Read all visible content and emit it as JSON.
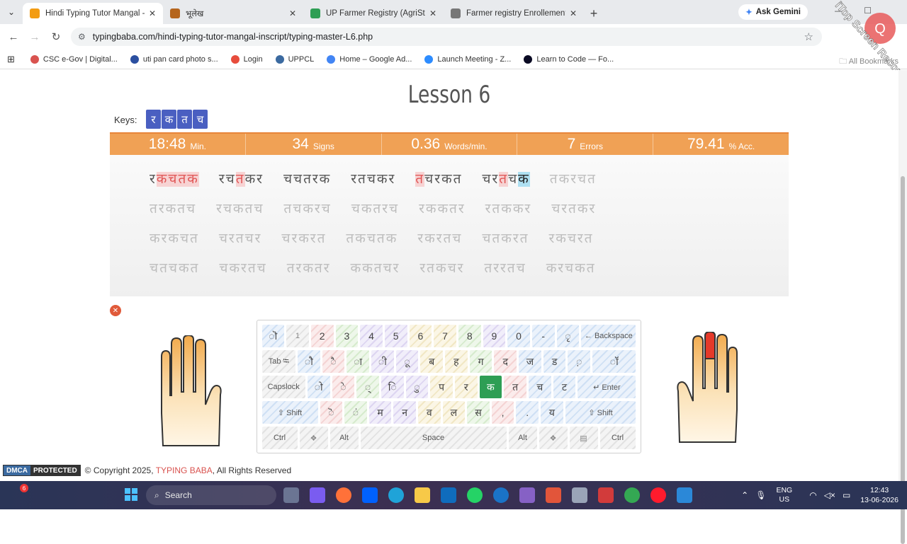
{
  "browser": {
    "tabs": [
      {
        "title": "Hindi Typing Tutor Mangal - Ins",
        "active": true,
        "color": "#f39c12"
      },
      {
        "title": "भूलेख",
        "active": false,
        "color": "#b5651d"
      },
      {
        "title": "UP Farmer Registry (AgriStack) |",
        "active": false,
        "color": "#2e9e54"
      },
      {
        "title": "Farmer registry Enrollement Da",
        "active": false,
        "color": "#777777"
      }
    ],
    "ask_gemini": "Ask Gemini",
    "url": "typingbaba.com/hindi-typing-tutor-mangal-inscript/typing-master-L6.php",
    "bookmarks": [
      {
        "label": "CSC e-Gov | Digital...",
        "color": "#d9534f"
      },
      {
        "label": "uti pan card photo s...",
        "color": "#2b4fa0"
      },
      {
        "label": "Login",
        "color": "#e74c3c"
      },
      {
        "label": "UPPCL",
        "color": "#3b6aa0"
      },
      {
        "label": "Home – Google Ad...",
        "color": "#4285f4"
      },
      {
        "label": "Launch Meeting - Z...",
        "color": "#2d8cff"
      },
      {
        "label": "Learn to Code — Fo...",
        "color": "#0a0a23"
      }
    ],
    "all_bookmarks": "All Bookmarks",
    "watermark": "iTop Screen Recorder"
  },
  "lesson": {
    "title": "Lesson 6",
    "keys_label": "Keys:",
    "keys": [
      "र",
      "क",
      "त",
      "च"
    ]
  },
  "stats": [
    {
      "value": "18:48",
      "unit": "Min."
    },
    {
      "value": "34",
      "unit": "Signs"
    },
    {
      "value": "0.36",
      "unit": "Words/min."
    },
    {
      "value": "7",
      "unit": "Errors"
    },
    {
      "value": "79.41",
      "unit": "% Acc."
    }
  ],
  "typing": {
    "line1": [
      {
        "segs": [
          {
            "t": "र",
            "s": "ok"
          },
          {
            "t": "कचतक",
            "s": "err"
          }
        ]
      },
      {
        "segs": [
          {
            "t": "रच",
            "s": "ok"
          },
          {
            "t": "त",
            "s": "err"
          },
          {
            "t": "कर",
            "s": "ok"
          }
        ]
      },
      {
        "segs": [
          {
            "t": "चचतरक",
            "s": "ok"
          }
        ]
      },
      {
        "segs": [
          {
            "t": "रतचकर",
            "s": "ok"
          }
        ]
      },
      {
        "segs": [
          {
            "t": "त",
            "s": "err"
          },
          {
            "t": "चरकत",
            "s": "ok"
          }
        ]
      },
      {
        "segs": [
          {
            "t": "चर",
            "s": "ok"
          },
          {
            "t": "त",
            "s": "err"
          },
          {
            "t": "च",
            "s": "ok"
          },
          {
            "t": "क",
            "s": "cur"
          }
        ]
      },
      {
        "segs": [
          {
            "t": "तकरचत",
            "s": "pend"
          }
        ]
      }
    ],
    "line2": [
      "तरकतच",
      "रचकतच",
      "तचकरच",
      "चकतरच",
      "रककतर",
      "रतककर",
      "चरतकर"
    ],
    "line3": [
      "करकचत",
      "चरतचर",
      "चरकरत",
      "तकचतक",
      "रकरतच",
      "चतकरत",
      "रकचरत"
    ],
    "line4": [
      "चतचकत",
      "चकरतच",
      "तरकतर",
      "ककतचर",
      "रतकचर",
      "तररतच",
      "करचकत"
    ]
  },
  "keyboard": {
    "row1": [
      "ॊ",
      "1",
      "2",
      "3",
      "4",
      "5",
      "6",
      "7",
      "8",
      "9",
      "0",
      "-",
      "ृ",
      "← Backspace"
    ],
    "row2": [
      "Tab ⭾",
      "ौ",
      "ै",
      "ा",
      "ी",
      "ू",
      "ब",
      "ह",
      "ग",
      "द",
      "ज",
      "ड",
      "़",
      "ॉ"
    ],
    "row3": [
      "Capslock",
      "ो",
      "े",
      "्",
      "ि",
      "ु",
      "प",
      "र",
      "क",
      "त",
      "च",
      "ट",
      "↵ Enter"
    ],
    "row4": [
      "⇧ Shift",
      "ॆ",
      "ं",
      "म",
      "न",
      "व",
      "ल",
      "स",
      ",",
      ".",
      "य",
      "⇧ Shift"
    ],
    "row5": [
      "Ctrl",
      "❖",
      "Alt",
      "Space",
      "Alt",
      "❖",
      "▤",
      "Ctrl"
    ],
    "highlight": "क"
  },
  "footer": {
    "dmca_a": "DMCA",
    "dmca_b": "PROTECTED",
    "copyright_prefix": "© Copyright 2025,",
    "brand": "TYPING BABA",
    "copyright_suffix": ", All Rights Reserved"
  },
  "taskbar": {
    "search": "Search",
    "lang": "ENG",
    "region": "US",
    "time": "12:43",
    "date": "13-06-2026",
    "badge": "6"
  }
}
